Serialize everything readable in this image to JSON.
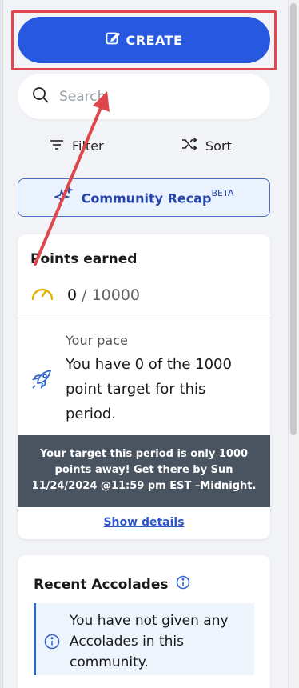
{
  "create": {
    "label": "CREATE"
  },
  "search": {
    "placeholder": "Search"
  },
  "toolbar": {
    "filter_label": "Filter",
    "sort_label": "Sort"
  },
  "recap": {
    "label": "Community Recap",
    "badge": "BETA"
  },
  "points": {
    "title": "Points earned",
    "current": "0",
    "total": "/ 10000",
    "pace_label": "Your pace",
    "pace_text": "You have 0 of the 1000 point target for this period.",
    "target_banner": "Your target this period is only 1000 points away! Get there by Sun 11/24/2024 @11:59 pm EST –Midnight.",
    "show_details": "Show details"
  },
  "accolades": {
    "title": "Recent Accolades",
    "empty_text": "You have not given any Accolades in this community."
  },
  "colors": {
    "primary": "#2759e0",
    "highlight": "#e0474c",
    "banner_bg": "#4a5360",
    "gauge": "#e0b400",
    "link": "#2d56c9"
  },
  "icons": [
    "edit-icon",
    "search-icon",
    "filter-icon",
    "sort-icon",
    "sparkle-icon",
    "gauge-icon",
    "rocket-icon",
    "info-icon",
    "annotation-arrow"
  ]
}
